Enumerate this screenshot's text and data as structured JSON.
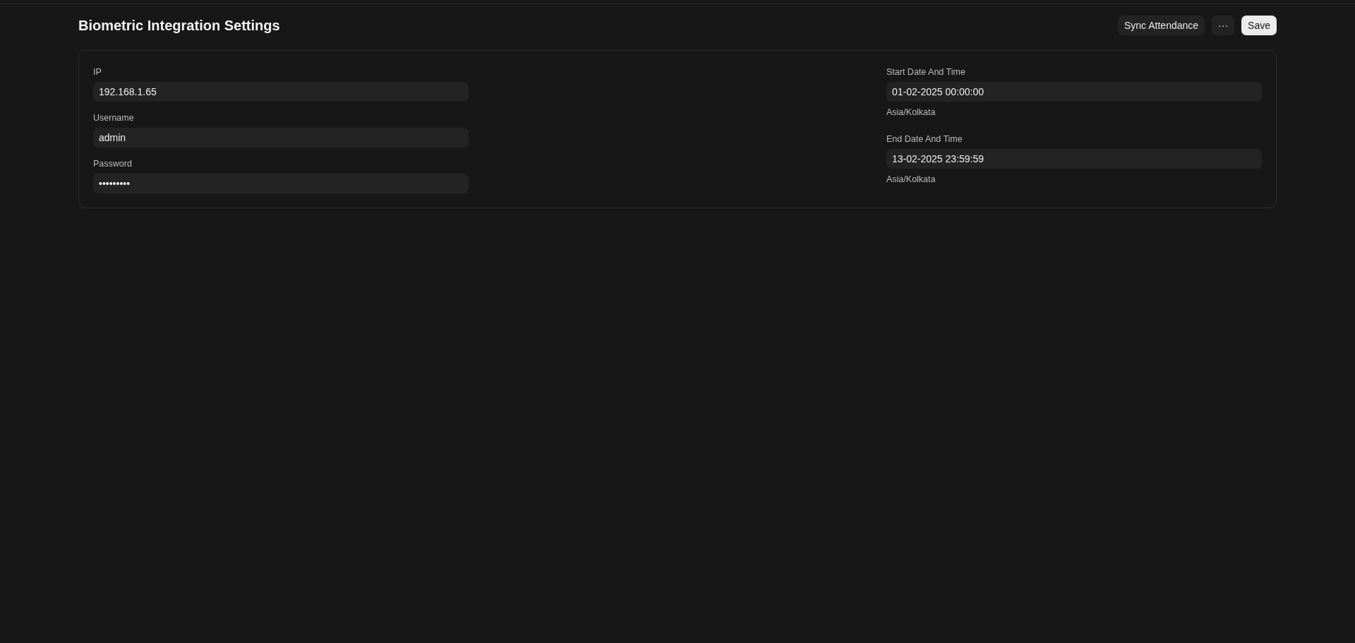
{
  "page": {
    "title": "Biometric Integration Settings"
  },
  "actions": [
    {
      "label": "Sync Attendance",
      "kind": "secondary"
    },
    {
      "label": "···",
      "kind": "secondary"
    },
    {
      "label": "Save",
      "kind": "primary"
    }
  ],
  "columns": [
    {
      "fields": [
        {
          "label": "IP",
          "value": "192.168.1.65"
        },
        {
          "label": "Username",
          "value": "admin"
        },
        {
          "label": "Password",
          "value": "•••••••••"
        }
      ]
    },
    {
      "fields": [
        {
          "label": "Start Date And Time",
          "value": "01-02-2025 00:00:00",
          "description": "Asia/Kolkata"
        },
        {
          "label": "End Date And Time",
          "value": "13-02-2025 23:59:59",
          "description": "Asia/Kolkata"
        }
      ]
    }
  ]
}
